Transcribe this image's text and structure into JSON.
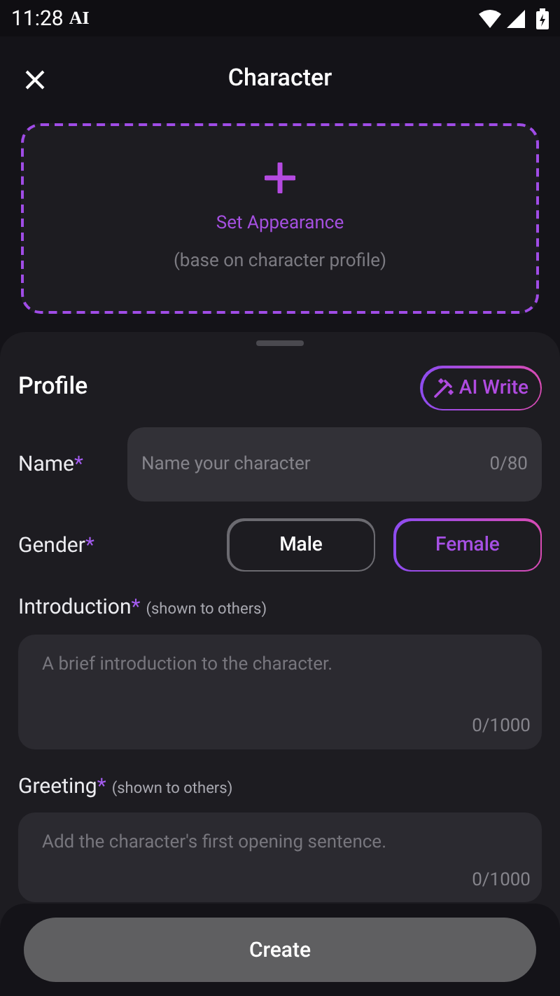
{
  "status_bar": {
    "time": "11:28",
    "notification": "AI"
  },
  "header": {
    "title": "Character"
  },
  "appearance": {
    "label": "Set Appearance",
    "hint": "(base on character profile)"
  },
  "profile": {
    "title": "Profile",
    "ai_button": "AI Write"
  },
  "name_field": {
    "label": "Name",
    "required_mark": "*",
    "placeholder": "Name your character",
    "counter": "0/80"
  },
  "gender": {
    "label": "Gender",
    "required_mark": "*",
    "options": [
      {
        "label": "Male",
        "selected": false
      },
      {
        "label": "Female",
        "selected": true
      }
    ]
  },
  "areas": [
    {
      "label": "Introduction",
      "required_mark": "*",
      "note": "(shown to others)",
      "placeholder": "A brief introduction to the character.",
      "counter": "0/1000"
    },
    {
      "label": "Greeting",
      "required_mark": "*",
      "note": "(shown to others)",
      "placeholder": "Add the character's first opening sentence.",
      "counter": "0/1000"
    }
  ],
  "create_button": "Create"
}
